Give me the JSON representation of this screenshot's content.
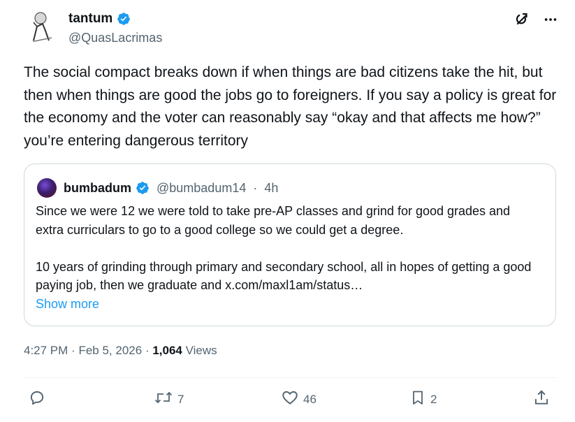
{
  "author": {
    "name": "tantum",
    "handle": "@QuasLacrimas"
  },
  "tweet": {
    "text": "The social compact breaks down if when things are bad citizens take the hit, but then when things are good the jobs go to foreigners. If you say a policy is great for the economy and the voter can reasonably say “okay and that affects me how?” you’re entering dangerous territory"
  },
  "quote": {
    "name": "bumbadum",
    "handle": "@bumbadum14",
    "separator": "·",
    "time": "4h",
    "text": "Since we were 12 we were told to take pre-AP classes and grind for good grades and extra curriculars to go to a good college so we could get a degree.\n\n10 years of grinding through primary and secondary school, all in hopes of getting a good paying job, then we graduate and x.com/maxl1am/status…",
    "show_more": "Show more"
  },
  "meta": {
    "time": "4:27 PM",
    "separator": "·",
    "date": "Feb 5, 2026",
    "views_count": "1,064",
    "views_label": "Views"
  },
  "actions": {
    "reply_count": "",
    "retweet_count": "7",
    "like_count": "46",
    "bookmark_count": "2"
  },
  "colors": {
    "accent": "#1d9bf0",
    "text": "#0f1419",
    "secondary": "#536471",
    "border": "#cfd9de"
  },
  "icons": [
    "verified-badge-icon",
    "grok-icon",
    "more-icon",
    "reply-icon",
    "retweet-icon",
    "like-icon",
    "bookmark-icon",
    "share-icon"
  ]
}
